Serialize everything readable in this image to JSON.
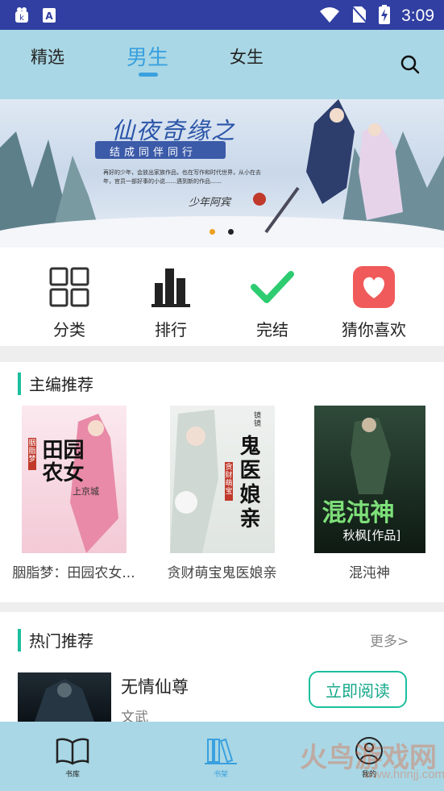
{
  "status_bar": {
    "time": "3:09"
  },
  "top_tabs": [
    {
      "label": "精选",
      "active": false
    },
    {
      "label": "男生",
      "active": true
    },
    {
      "label": "女生",
      "active": false
    }
  ],
  "banner": {
    "title": "仙夜奇缘之",
    "subtitle": "结成同伴同行",
    "author": "少年阿宾",
    "text": "再好的少年，会放出家族作品，也在写作和时代世界，从小在去年，官员一部好事的小说……遇到新的作品……",
    "page_indicator": {
      "count": 2,
      "active_index": 0,
      "active_color": "#f0a020",
      "inactive_color": "#222222"
    }
  },
  "shortcuts": [
    {
      "label": "分类",
      "icon": "grid-icon"
    },
    {
      "label": "排行",
      "icon": "bar-chart-icon"
    },
    {
      "label": "完结",
      "icon": "checkmark-icon"
    },
    {
      "label": "猜你喜欢",
      "icon": "heart-icon"
    }
  ],
  "editor_picks": {
    "title": "主编推荐",
    "books": [
      {
        "title": "胭脂梦：田园农女...",
        "cover_title": "田园农女",
        "cover_side": "上京城",
        "cover_author": "胭脂梦"
      },
      {
        "title": "贪财萌宝鬼医娘亲",
        "cover_title": "鬼医娘亲",
        "cover_side": "贪财萌宝",
        "cover_author": "镜镜"
      },
      {
        "title": "混沌神",
        "cover_title": "混沌神",
        "cover_side": "",
        "cover_author": "秋枫[作品]"
      }
    ]
  },
  "hot_picks": {
    "title": "热门推荐",
    "more_label": "更多>",
    "item": {
      "title": "无情仙尊",
      "tag": "文武",
      "button_label": "立即阅读"
    }
  },
  "bottom_tabs": [
    {
      "label": "书库",
      "icon": "open-book-icon",
      "active": false
    },
    {
      "label": "书架",
      "icon": "bookshelf-icon",
      "active": true
    },
    {
      "label": "我的",
      "icon": "user-icon",
      "active": false
    }
  ],
  "watermark": {
    "text": "火鸟游戏网",
    "url": "www.hnnjj.com"
  },
  "colors": {
    "accent": "#1bbf9e",
    "tab_active": "#3aa0df",
    "nav_bg": "#a9d7e5",
    "status_bg": "#303fa1"
  }
}
